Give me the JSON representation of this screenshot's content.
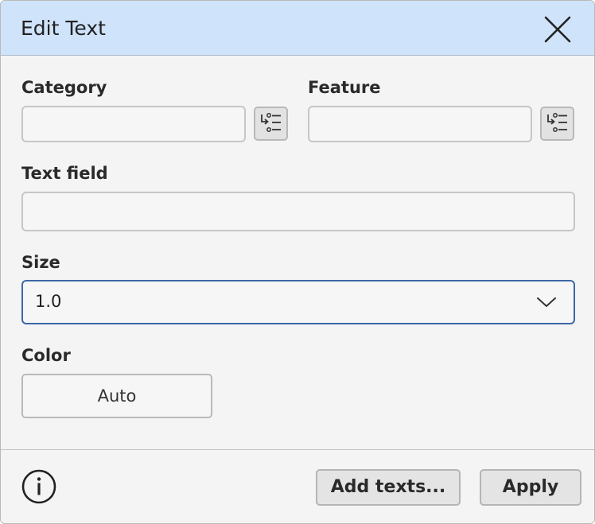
{
  "dialog": {
    "title": "Edit Text",
    "close_icon": "close-icon"
  },
  "fields": {
    "category": {
      "label": "Category",
      "value": "",
      "picker_icon": "list-picker-icon"
    },
    "feature": {
      "label": "Feature",
      "value": "",
      "picker_icon": "list-picker-icon"
    },
    "text_field": {
      "label": "Text field",
      "value": ""
    },
    "size": {
      "label": "Size",
      "selected": "1.0",
      "icon": "chevron-down-icon"
    },
    "color": {
      "label": "Color",
      "value": "Auto"
    }
  },
  "footer": {
    "info_icon": "info-icon",
    "add_texts_label": "Add texts...",
    "apply_label": "Apply"
  }
}
